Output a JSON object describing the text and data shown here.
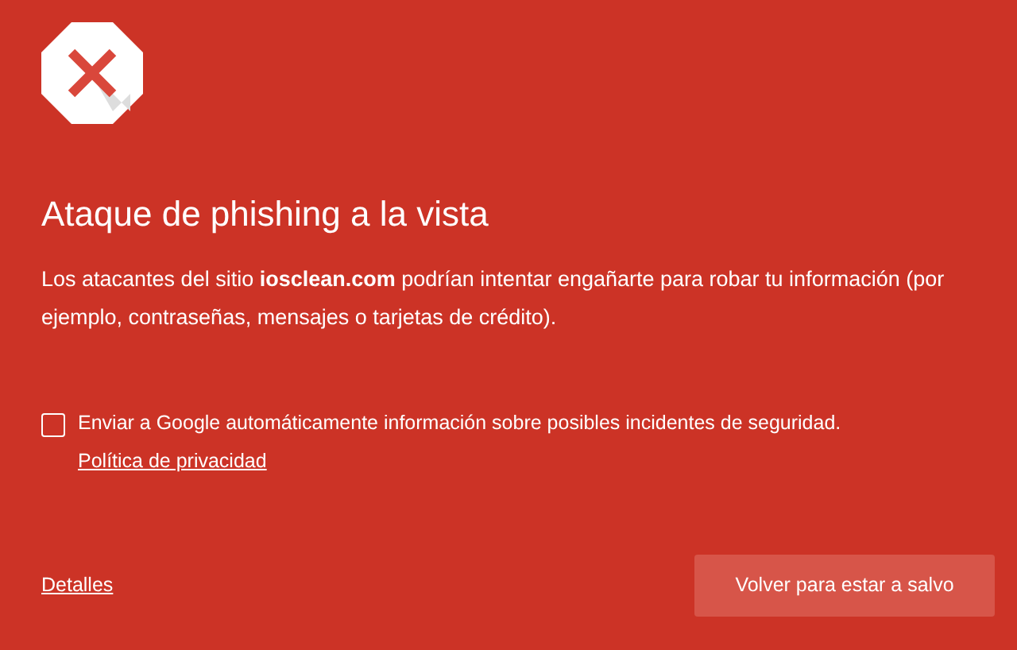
{
  "icon": {
    "kind": "error"
  },
  "title": "Ataque de phishing a la vista",
  "message": "Los atacantes del sitio **iosclean.com** podrían intentar engañarte para robar tu información (por ejemplo, contraseñas, mensajes o tarjetas de crédito).",
  "report": {
    "checked": false,
    "label": "Enviar a Google automáticamente información sobre posibles incidentes de seguridad.",
    "link": "Política de privacidad"
  },
  "details_link": "Detalles",
  "primary_button": "Volver para estar a salvo"
}
